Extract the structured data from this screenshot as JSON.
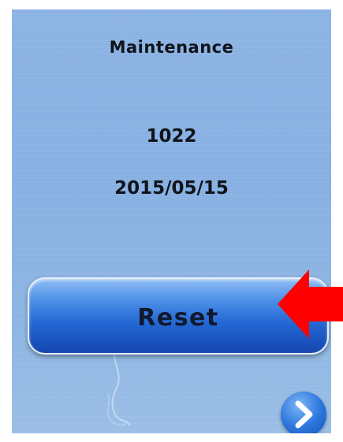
{
  "screen": {
    "title": "Maintenance",
    "counter": "1022",
    "date": "2015/05/15"
  },
  "buttons": {
    "reset_label": "Reset",
    "next_icon": "chevron-right-icon"
  },
  "annotation": {
    "arrow_color": "#ff0000",
    "arrow_icon": "arrow-left-icon"
  },
  "colors": {
    "screen_bg": "#8cb4e6",
    "button_blue": "#2265d2",
    "text": "#10141a"
  }
}
